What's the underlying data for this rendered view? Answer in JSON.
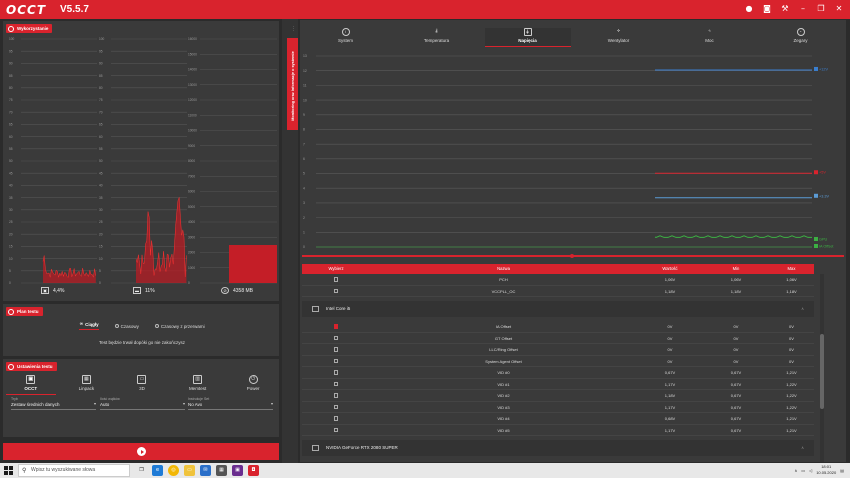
{
  "app": {
    "logo": "OCCT",
    "version": "V5.5.7",
    "titlebar_icons": [
      "record-icon",
      "camera-icon",
      "wrench-icon",
      "minimize-icon",
      "maximize-icon",
      "close-icon"
    ]
  },
  "usage": {
    "title": "Wykorzystanie",
    "cpu_value": "4,4%",
    "gpu_value": "11%",
    "ram_value": "4358 MB",
    "axis_left": [
      "100",
      "95",
      "90",
      "85",
      "80",
      "75",
      "70",
      "65",
      "60",
      "55",
      "50",
      "45",
      "40",
      "35",
      "30",
      "25",
      "20",
      "15",
      "10",
      "5",
      "0"
    ],
    "axis_mid": [
      "100",
      "95",
      "90",
      "85",
      "80",
      "75",
      "70",
      "65",
      "60",
      "55",
      "50",
      "45",
      "40",
      "35",
      "30",
      "25",
      "20",
      "15",
      "10",
      "5",
      "0"
    ],
    "axis_right": [
      "16000",
      "15000",
      "14000",
      "13000",
      "12000",
      "11000",
      "10000",
      "9000",
      "8000",
      "7000",
      "6000",
      "5000",
      "4000",
      "3000",
      "2000",
      "1000",
      "0"
    ]
  },
  "plan": {
    "title": "Plan testu",
    "options": [
      "Ciągły",
      "Czasowy",
      "Czasowy z przerwami"
    ],
    "selected": 0,
    "description": "Test będzie trwał dopóki go nie zakończysz"
  },
  "settings": {
    "title": "Ustawienia testu",
    "tests": [
      "OCCT",
      "Linpack",
      "3D",
      "Memtest",
      "Power"
    ],
    "selected": 0,
    "fields": [
      {
        "label": "Tryb",
        "value": "Zestaw średnich danych"
      },
      {
        "label": "Ilość wątków",
        "value": "Auto"
      },
      {
        "label": "Instrukcje Set",
        "value": "No Avx"
      }
    ]
  },
  "sidebar_tab": "Monitoring oraz Informacje o systemie",
  "monitor": {
    "tabs": [
      "System",
      "Temperatura",
      "Napięcia",
      "Wentylator",
      "Moc",
      "Zegary"
    ],
    "selected": 2,
    "volt_axis": [
      "13",
      "12",
      "11",
      "10",
      "9",
      "8",
      "7",
      "6",
      "5",
      "4",
      "3",
      "2",
      "1",
      "0"
    ],
    "legend": [
      {
        "label": "+12V",
        "color": "#3a7fd0"
      },
      {
        "label": "+5V",
        "color": "#d9232d"
      },
      {
        "label": "+3.3V",
        "color": "#5b9bd5"
      },
      {
        "label": "GPU",
        "color": "#3cb043"
      },
      {
        "label": "IA Offset",
        "color": "#3cb043"
      }
    ],
    "columns": [
      "Wybierz",
      "Nazwa",
      "Wartość",
      "Min",
      "Max"
    ],
    "rows_top": [
      {
        "name": "PCH",
        "value": "1,06V",
        "min": "1,06V",
        "max": "1,06V",
        "checked": false
      },
      {
        "name": "VCCPLL_OC",
        "value": "1,18V",
        "min": "1,18V",
        "max": "1,18V",
        "checked": false
      }
    ],
    "group1": "Intel Core i5",
    "rows_cpu": [
      {
        "name": "IA Offset",
        "value": "0V",
        "min": "0V",
        "max": "0V",
        "checked": true
      },
      {
        "name": "GT Offset",
        "value": "0V",
        "min": "0V",
        "max": "0V",
        "checked": false
      },
      {
        "name": "LLC/Ring Offset",
        "value": "0V",
        "min": "0V",
        "max": "0V",
        "checked": false
      },
      {
        "name": "System Agent Offset",
        "value": "0V",
        "min": "0V",
        "max": "0V",
        "checked": false
      },
      {
        "name": "VID #0",
        "value": "0,67V",
        "min": "0,67V",
        "max": "1,21V",
        "checked": false
      },
      {
        "name": "VID #1",
        "value": "1,17V",
        "min": "0,67V",
        "max": "1,22V",
        "checked": false
      },
      {
        "name": "VID #2",
        "value": "1,18V",
        "min": "0,67V",
        "max": "1,22V",
        "checked": false
      },
      {
        "name": "VID #3",
        "value": "1,17V",
        "min": "0,67V",
        "max": "1,22V",
        "checked": false
      },
      {
        "name": "VID #4",
        "value": "0,68V",
        "min": "0,67V",
        "max": "1,21V",
        "checked": false
      },
      {
        "name": "VID #5",
        "value": "1,17V",
        "min": "0,67V",
        "max": "1,21V",
        "checked": false
      }
    ],
    "group2": "NVIDIA GeForce RTX 2080 SUPER",
    "rows_gpu": [
      {
        "name": "GPU",
        "value": "0,64V",
        "min": "0,64V",
        "max": "0,78V",
        "checked": true
      }
    ]
  },
  "taskbar": {
    "search_placeholder": "Wpisz tu wyszukiwane słowa",
    "time": "18:01",
    "date": "10.05.2020"
  }
}
